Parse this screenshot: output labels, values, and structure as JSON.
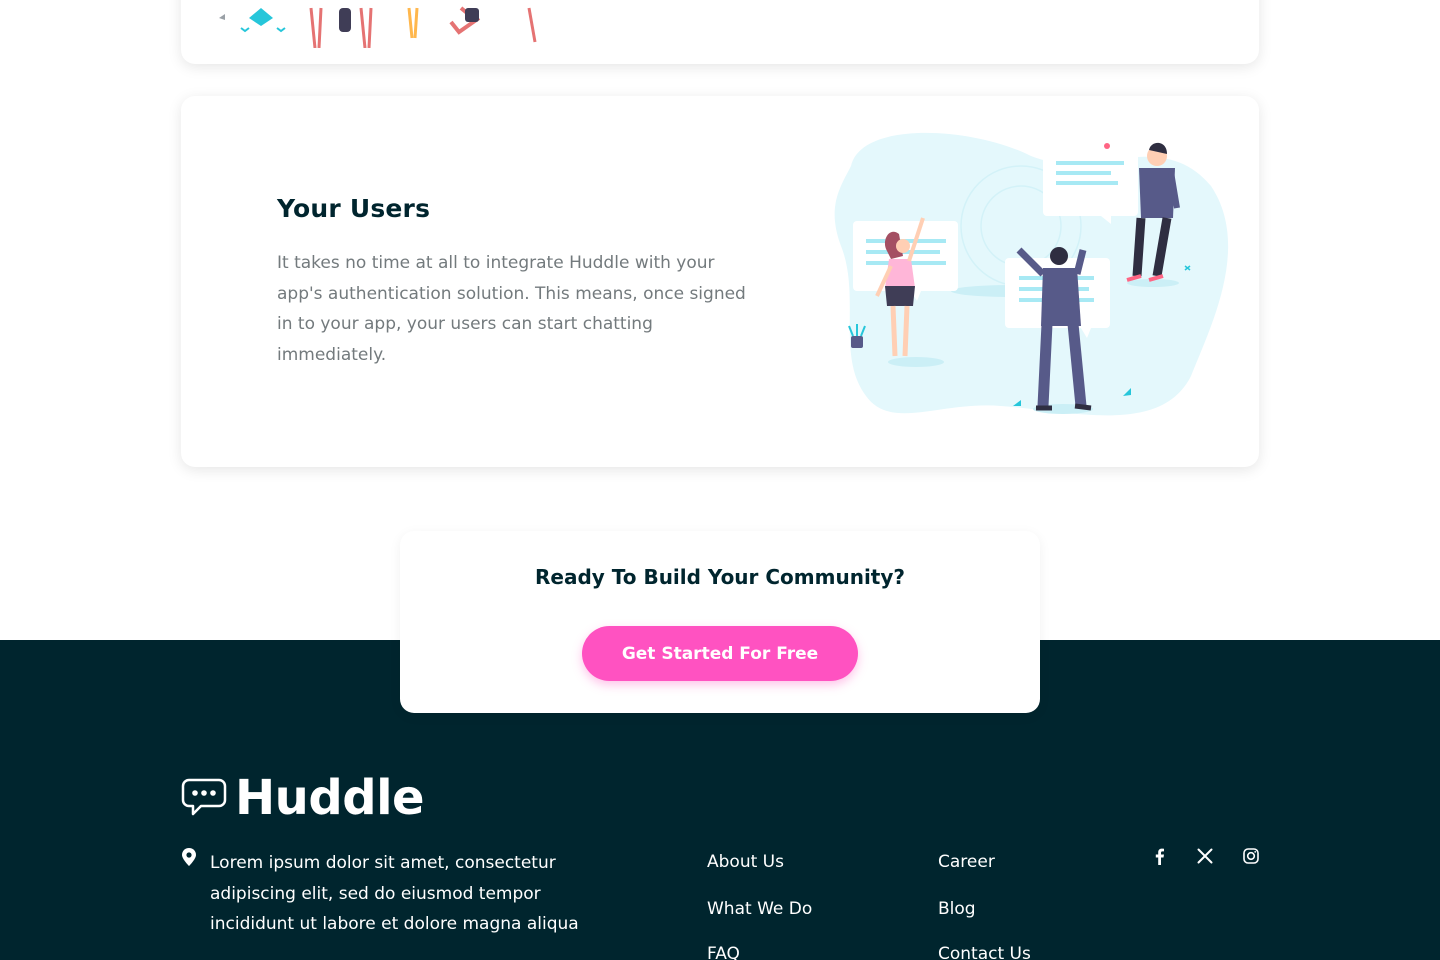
{
  "features": {
    "users": {
      "title": "Your Users",
      "text": "It takes no time at all to integrate Huddle with your app's authentication solution. This means, once signed in to your app, your users can start chatting immediately."
    }
  },
  "cta": {
    "title": "Ready To Build Your Community?",
    "button_label": "Get Started For Free"
  },
  "footer": {
    "brand": "Huddle",
    "address": "Lorem ipsum dolor sit amet, consectetur adipiscing elit, sed do eiusmod tempor incididunt ut labore et dolore magna aliqua",
    "links_col1": [
      "About Us",
      "What We Do",
      "FAQ"
    ],
    "links_col2": [
      "Career",
      "Blog",
      "Contact Us"
    ],
    "social": [
      "facebook-icon",
      "x-twitter-icon",
      "instagram-icon"
    ]
  },
  "colors": {
    "dark_bg": "#00252e",
    "accent_pink": "#ff52c1",
    "heading": "#00252e",
    "body_text": "#737a7d",
    "illustration_blue": "#e4f8fc"
  }
}
